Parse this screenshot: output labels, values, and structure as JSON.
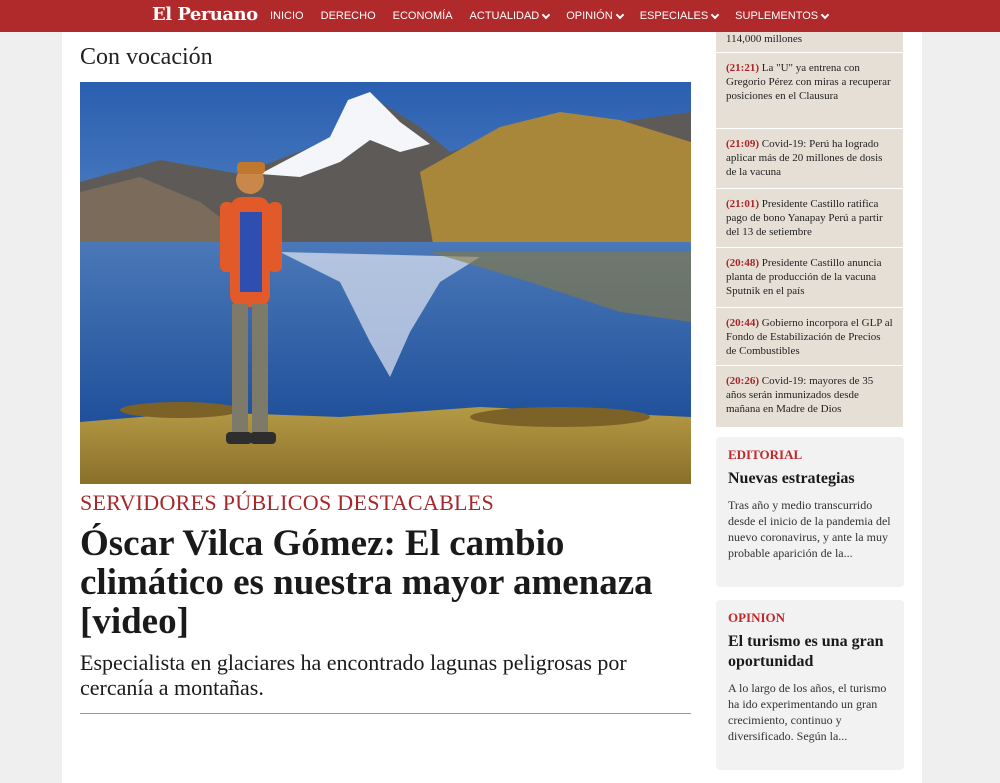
{
  "site": {
    "logo": "El Peruano"
  },
  "nav": [
    {
      "label": "INICIO",
      "dropdown": false
    },
    {
      "label": "DERECHO",
      "dropdown": false
    },
    {
      "label": "ECONOMÍA",
      "dropdown": false
    },
    {
      "label": "ACTUALIDAD",
      "dropdown": true
    },
    {
      "label": "OPINIÓN",
      "dropdown": true
    },
    {
      "label": "ESPECIALES",
      "dropdown": true
    },
    {
      "label": "SUPLEMENTOS",
      "dropdown": true
    }
  ],
  "main": {
    "section_label": "Con vocación",
    "kicker": "SERVIDORES PÚBLICOS DESTACABLES",
    "headline": "Óscar Vilca Gómez: El cambio climático es nuestra mayor amenaza [video]",
    "summary": "Especialista en glaciares ha encontrado lagunas peligrosas por cercanía a montañas."
  },
  "latest": {
    "partial_text": "114,000 millones",
    "items": [
      {
        "time": "(21:21)",
        "text": "La \"U\" ya entrena con Gregorio Pérez con miras a recuperar posiciones en el Clausura"
      },
      {
        "time": "(21:09)",
        "text": "Covid-19: Perú ha logrado aplicar más de 20 millones de dosis de la vacuna"
      },
      {
        "time": "(21:01)",
        "text": "Presidente Castillo ratifica pago de bono Yanapay Perú a partir del 13 de setiembre"
      },
      {
        "time": "(20:48)",
        "text": "Presidente Castillo anuncia planta de producción de la vacuna Sputnik en el país"
      },
      {
        "time": "(20:44)",
        "text": "Gobierno incorpora el GLP al Fondo de Estabilización de Precios de Combustibles"
      },
      {
        "time": "(20:26)",
        "text": "Covid-19: mayores de 35 años serán inmunizados desde mañana en Madre de Dios"
      }
    ]
  },
  "editorial": {
    "label": "EDITORIAL",
    "title": "Nuevas estrategias",
    "text": "Tras año y medio transcurrido desde el inicio de la pandemia del nuevo coronavirus, y ante la muy probable aparición de la..."
  },
  "opinion": {
    "label": "OPINION",
    "title": "El turismo es una gran oportunidad",
    "text": "A lo largo de los años, el turismo ha ido experimentando un gran crecimiento, continuo y diversificado. Según la..."
  },
  "colors": {
    "brand": "#b0292b",
    "accent_text": "#a8262a",
    "news_bg": "#e6dfd6"
  }
}
